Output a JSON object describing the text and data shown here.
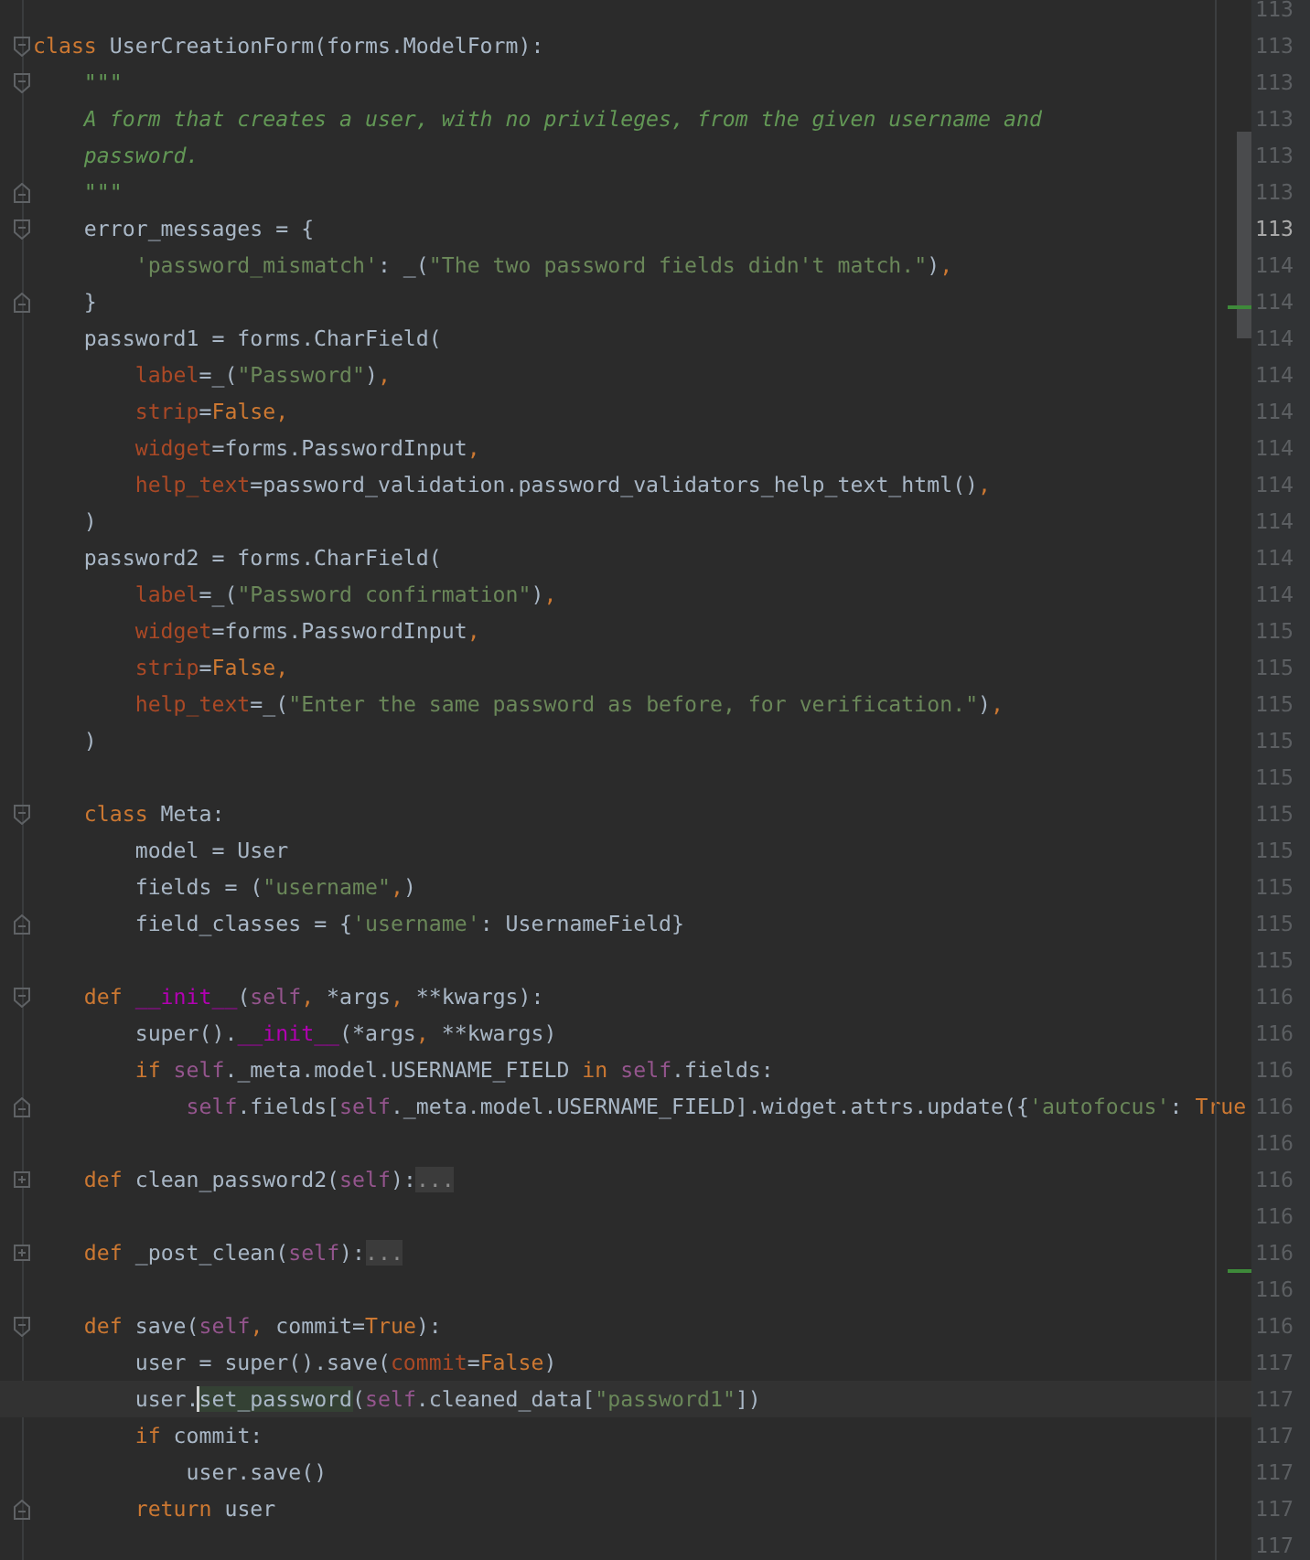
{
  "editor": {
    "lines": [
      {
        "kind": "plain",
        "current": false
      },
      {
        "kind": "fold-start",
        "current": false,
        "tokens": [
          {
            "text": "class",
            "kind": "keyword"
          },
          {
            "text": " UserCreationForm(forms.ModelForm):",
            "kind": "plain"
          }
        ]
      },
      {
        "kind": "fold-start",
        "current": false,
        "tokens": [
          {
            "text": "    \"\"\"",
            "kind": "docstring"
          }
        ]
      },
      {
        "kind": "plain",
        "current": false,
        "tokens": [
          {
            "text": "    A form that creates a user, with no privileges, from the given username and",
            "kind": "docstring"
          }
        ]
      },
      {
        "kind": "plain",
        "current": false,
        "tokens": [
          {
            "text": "    password.",
            "kind": "docstring"
          }
        ]
      },
      {
        "kind": "fold-end",
        "current": false,
        "tokens": [
          {
            "text": "    \"\"\"",
            "kind": "docstring"
          }
        ]
      },
      {
        "kind": "fold-start",
        "current": false,
        "tokens": [
          {
            "text": "    error_messages = {",
            "kind": "plain"
          }
        ]
      },
      {
        "kind": "plain",
        "current": false,
        "tokens": [
          {
            "text": "        'password_mismatch'",
            "kind": "string"
          },
          {
            "text": ": _(",
            "kind": "plain"
          },
          {
            "text": "\"The two password fields didn't match.\"",
            "kind": "string"
          },
          {
            "text": ")",
            "kind": "plain"
          },
          {
            "text": ",",
            "kind": "comma"
          }
        ]
      },
      {
        "kind": "fold-end",
        "current": false,
        "tokens": [
          {
            "text": "    }",
            "kind": "plain"
          }
        ]
      },
      {
        "kind": "plain",
        "current": false,
        "tokens": [
          {
            "text": "    password1 = forms.CharField(",
            "kind": "plain"
          }
        ]
      },
      {
        "kind": "plain",
        "current": false,
        "tokens": [
          {
            "text": "        label",
            "kind": "named-arg"
          },
          {
            "text": "=_(",
            "kind": "plain"
          },
          {
            "text": "\"Password\"",
            "kind": "string"
          },
          {
            "text": ")",
            "kind": "plain"
          },
          {
            "text": ",",
            "kind": "comma"
          }
        ]
      },
      {
        "kind": "plain",
        "current": false,
        "tokens": [
          {
            "text": "        strip",
            "kind": "named-arg"
          },
          {
            "text": "=",
            "kind": "plain"
          },
          {
            "text": "False",
            "kind": "keyword"
          },
          {
            "text": ",",
            "kind": "comma"
          }
        ]
      },
      {
        "kind": "plain",
        "current": false,
        "tokens": [
          {
            "text": "        widget",
            "kind": "named-arg"
          },
          {
            "text": "=forms.PasswordInput",
            "kind": "plain"
          },
          {
            "text": ",",
            "kind": "comma"
          }
        ]
      },
      {
        "kind": "plain",
        "current": false,
        "tokens": [
          {
            "text": "        help_text",
            "kind": "named-arg"
          },
          {
            "text": "=password_validation.password_validators_help_text_html()",
            "kind": "plain"
          },
          {
            "text": ",",
            "kind": "comma"
          }
        ]
      },
      {
        "kind": "plain",
        "current": false,
        "tokens": [
          {
            "text": "    )",
            "kind": "plain"
          }
        ]
      },
      {
        "kind": "plain",
        "current": false,
        "tokens": [
          {
            "text": "    password2 = forms.CharField(",
            "kind": "plain"
          }
        ]
      },
      {
        "kind": "plain",
        "current": false,
        "tokens": [
          {
            "text": "        label",
            "kind": "named-arg"
          },
          {
            "text": "=_(",
            "kind": "plain"
          },
          {
            "text": "\"Password confirmation\"",
            "kind": "string"
          },
          {
            "text": ")",
            "kind": "plain"
          },
          {
            "text": ",",
            "kind": "comma"
          }
        ]
      },
      {
        "kind": "plain",
        "current": false,
        "tokens": [
          {
            "text": "        widget",
            "kind": "named-arg"
          },
          {
            "text": "=forms.PasswordInput",
            "kind": "plain"
          },
          {
            "text": ",",
            "kind": "comma"
          }
        ]
      },
      {
        "kind": "plain",
        "current": false,
        "tokens": [
          {
            "text": "        strip",
            "kind": "named-arg"
          },
          {
            "text": "=",
            "kind": "plain"
          },
          {
            "text": "False",
            "kind": "keyword"
          },
          {
            "text": ",",
            "kind": "comma"
          }
        ]
      },
      {
        "kind": "plain",
        "current": false,
        "tokens": [
          {
            "text": "        help_text",
            "kind": "named-arg"
          },
          {
            "text": "=_(",
            "kind": "plain"
          },
          {
            "text": "\"Enter the same password as before, for verification.\"",
            "kind": "string"
          },
          {
            "text": ")",
            "kind": "plain"
          },
          {
            "text": ",",
            "kind": "comma"
          }
        ]
      },
      {
        "kind": "plain",
        "current": false,
        "tokens": [
          {
            "text": "    )",
            "kind": "plain"
          }
        ]
      },
      {
        "kind": "plain",
        "current": false
      },
      {
        "kind": "fold-start",
        "current": false,
        "tokens": [
          {
            "text": "    class",
            "kind": "keyword"
          },
          {
            "text": " Meta:",
            "kind": "plain"
          }
        ]
      },
      {
        "kind": "plain",
        "current": false,
        "tokens": [
          {
            "text": "        model = User",
            "kind": "plain"
          }
        ]
      },
      {
        "kind": "plain",
        "current": false,
        "tokens": [
          {
            "text": "        fields = (",
            "kind": "plain"
          },
          {
            "text": "\"username\"",
            "kind": "string"
          },
          {
            "text": ",",
            "kind": "comma"
          },
          {
            "text": ")",
            "kind": "plain"
          }
        ]
      },
      {
        "kind": "fold-end",
        "current": false,
        "tokens": [
          {
            "text": "        field_classes = {",
            "kind": "plain"
          },
          {
            "text": "'username'",
            "kind": "string"
          },
          {
            "text": ": UsernameField}",
            "kind": "plain"
          }
        ]
      },
      {
        "kind": "plain",
        "current": false
      },
      {
        "kind": "fold-start",
        "current": false,
        "tokens": [
          {
            "text": "    def ",
            "kind": "keyword"
          },
          {
            "text": "__init__",
            "kind": "dunder"
          },
          {
            "text": "(",
            "kind": "plain"
          },
          {
            "text": "self",
            "kind": "self"
          },
          {
            "text": ",",
            "kind": "comma"
          },
          {
            "text": " *args",
            "kind": "plain"
          },
          {
            "text": ",",
            "kind": "comma"
          },
          {
            "text": " **kwargs):",
            "kind": "plain"
          }
        ]
      },
      {
        "kind": "plain",
        "current": false,
        "tokens": [
          {
            "text": "        super().",
            "kind": "plain"
          },
          {
            "text": "__init__",
            "kind": "dunder"
          },
          {
            "text": "(*args",
            "kind": "plain"
          },
          {
            "text": ",",
            "kind": "comma"
          },
          {
            "text": " **kwargs)",
            "kind": "plain"
          }
        ]
      },
      {
        "kind": "plain",
        "current": false,
        "tokens": [
          {
            "text": "        if ",
            "kind": "keyword"
          },
          {
            "text": "self",
            "kind": "self"
          },
          {
            "text": "._meta.model.USERNAME_FIELD ",
            "kind": "plain"
          },
          {
            "text": "in ",
            "kind": "keyword"
          },
          {
            "text": "self",
            "kind": "self"
          },
          {
            "text": ".fields:",
            "kind": "plain"
          }
        ]
      },
      {
        "kind": "fold-end",
        "current": false,
        "tokens": [
          {
            "text": "            self",
            "kind": "self"
          },
          {
            "text": ".fields[",
            "kind": "plain"
          },
          {
            "text": "self",
            "kind": "self"
          },
          {
            "text": "._meta.model.USERNAME_FIELD].widget.attrs.update({",
            "kind": "plain"
          },
          {
            "text": "'autofocus'",
            "kind": "string"
          },
          {
            "text": ": ",
            "kind": "plain"
          },
          {
            "text": "True",
            "kind": "keyword"
          }
        ]
      },
      {
        "kind": "plain",
        "current": false
      },
      {
        "kind": "folded",
        "current": false,
        "tokens": [
          {
            "text": "    def",
            "kind": "keyword"
          },
          {
            "text": " clean_password2(",
            "kind": "plain"
          },
          {
            "text": "self",
            "kind": "self"
          },
          {
            "text": "):",
            "kind": "plain"
          },
          {
            "text": "...",
            "kind": "folded"
          }
        ]
      },
      {
        "kind": "plain",
        "current": false
      },
      {
        "kind": "folded",
        "current": false,
        "tokens": [
          {
            "text": "    def",
            "kind": "keyword"
          },
          {
            "text": " _post_clean(",
            "kind": "plain"
          },
          {
            "text": "self",
            "kind": "self"
          },
          {
            "text": "):",
            "kind": "plain"
          },
          {
            "text": "...",
            "kind": "folded"
          }
        ]
      },
      {
        "kind": "plain",
        "current": false
      },
      {
        "kind": "fold-start",
        "current": false,
        "tokens": [
          {
            "text": "    def",
            "kind": "keyword"
          },
          {
            "text": " save(",
            "kind": "plain"
          },
          {
            "text": "self",
            "kind": "self"
          },
          {
            "text": ",",
            "kind": "comma"
          },
          {
            "text": " commit=",
            "kind": "plain"
          },
          {
            "text": "True",
            "kind": "keyword"
          },
          {
            "text": "):",
            "kind": "plain"
          }
        ]
      },
      {
        "kind": "plain",
        "current": false,
        "tokens": [
          {
            "text": "        user = super().save(",
            "kind": "plain"
          },
          {
            "text": "commit",
            "kind": "named-arg"
          },
          {
            "text": "=",
            "kind": "plain"
          },
          {
            "text": "False",
            "kind": "keyword"
          },
          {
            "text": ")",
            "kind": "plain"
          }
        ]
      },
      {
        "kind": "plain",
        "current": true,
        "tokens": [
          {
            "text": "        user.",
            "kind": "plain"
          },
          {
            "text": "set_password",
            "kind": "usage"
          },
          {
            "text": "(",
            "kind": "plain"
          },
          {
            "text": "self",
            "kind": "self"
          },
          {
            "text": ".cleaned_data[",
            "kind": "plain"
          },
          {
            "text": "\"password1\"",
            "kind": "string"
          },
          {
            "text": "])",
            "kind": "plain"
          }
        ]
      },
      {
        "kind": "plain",
        "current": false,
        "tokens": [
          {
            "text": "        if",
            "kind": "keyword"
          },
          {
            "text": " commit:",
            "kind": "plain"
          }
        ]
      },
      {
        "kind": "plain",
        "current": false,
        "tokens": [
          {
            "text": "            user.save()",
            "kind": "plain"
          }
        ]
      },
      {
        "kind": "fold-end",
        "current": false,
        "tokens": [
          {
            "text": "        return",
            "kind": "keyword"
          },
          {
            "text": " user",
            "kind": "plain"
          }
        ]
      },
      {
        "kind": "plain",
        "current": false
      }
    ]
  },
  "second_pane": {
    "line_numbers": [
      {
        "text": "113",
        "current": false
      },
      {
        "text": "113",
        "current": false
      },
      {
        "text": "113",
        "current": false
      },
      {
        "text": "113",
        "current": false
      },
      {
        "text": "113",
        "current": false
      },
      {
        "text": "113",
        "current": false
      },
      {
        "text": "113",
        "current": true
      },
      {
        "text": "114",
        "current": false
      },
      {
        "text": "114",
        "current": false
      },
      {
        "text": "114",
        "current": false
      },
      {
        "text": "114",
        "current": false
      },
      {
        "text": "114",
        "current": false
      },
      {
        "text": "114",
        "current": false
      },
      {
        "text": "114",
        "current": false
      },
      {
        "text": "114",
        "current": false
      },
      {
        "text": "114",
        "current": false
      },
      {
        "text": "114",
        "current": false
      },
      {
        "text": "115",
        "current": false
      },
      {
        "text": "115",
        "current": false
      },
      {
        "text": "115",
        "current": false
      },
      {
        "text": "115",
        "current": false
      },
      {
        "text": "115",
        "current": false
      },
      {
        "text": "115",
        "current": false
      },
      {
        "text": "115",
        "current": false
      },
      {
        "text": "115",
        "current": false
      },
      {
        "text": "115",
        "current": false
      },
      {
        "text": "115",
        "current": false
      },
      {
        "text": "116",
        "current": false
      },
      {
        "text": "116",
        "current": false
      },
      {
        "text": "116",
        "current": false
      },
      {
        "text": "116",
        "current": false
      },
      {
        "text": "116",
        "current": false
      },
      {
        "text": "116",
        "current": false
      },
      {
        "text": "116",
        "current": false
      },
      {
        "text": "116",
        "current": false
      },
      {
        "text": "116",
        "current": false
      },
      {
        "text": "116",
        "current": false
      },
      {
        "text": "117",
        "current": false
      },
      {
        "text": "117",
        "current": false
      },
      {
        "text": "117",
        "current": false
      },
      {
        "text": "117",
        "current": false
      },
      {
        "text": "117",
        "current": false
      },
      {
        "text": "117",
        "current": false
      }
    ]
  }
}
